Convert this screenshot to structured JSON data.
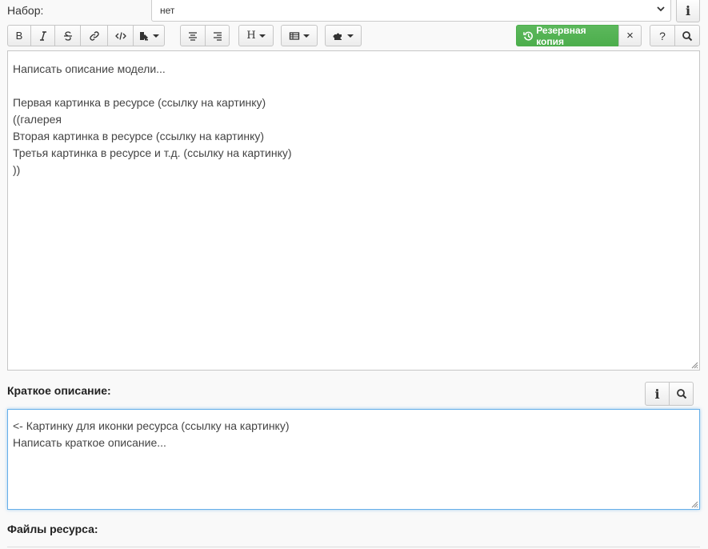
{
  "set_row": {
    "label": "Набор:",
    "select_value": "нет",
    "info_button_label": "i"
  },
  "toolbar": {
    "bold": "B",
    "heading": "H",
    "backup_label": "Резервная копия",
    "close_label": "×",
    "help_label": "?"
  },
  "editor": {
    "lines": [
      "Написать описание модели...",
      "",
      "Первая картинка в ресурсе (ссылку на картинку)",
      "((галерея",
      "Вторая картинка в ресурсе (ссылку на картинку)",
      "Третья картинка в ресурсе и т.д. (ссылку на картинку)",
      "))"
    ]
  },
  "short_description": {
    "label": "Краткое описание:",
    "info_button_label": "i",
    "lines": [
      "<- Картинку для иконки ресурса (ссылку на картинку)",
      "Написать краткое описание..."
    ]
  },
  "files": {
    "label": "Файлы ресурса:"
  },
  "colors": {
    "backup_green": "#5cb85c",
    "focus_blue": "#66afe9"
  }
}
